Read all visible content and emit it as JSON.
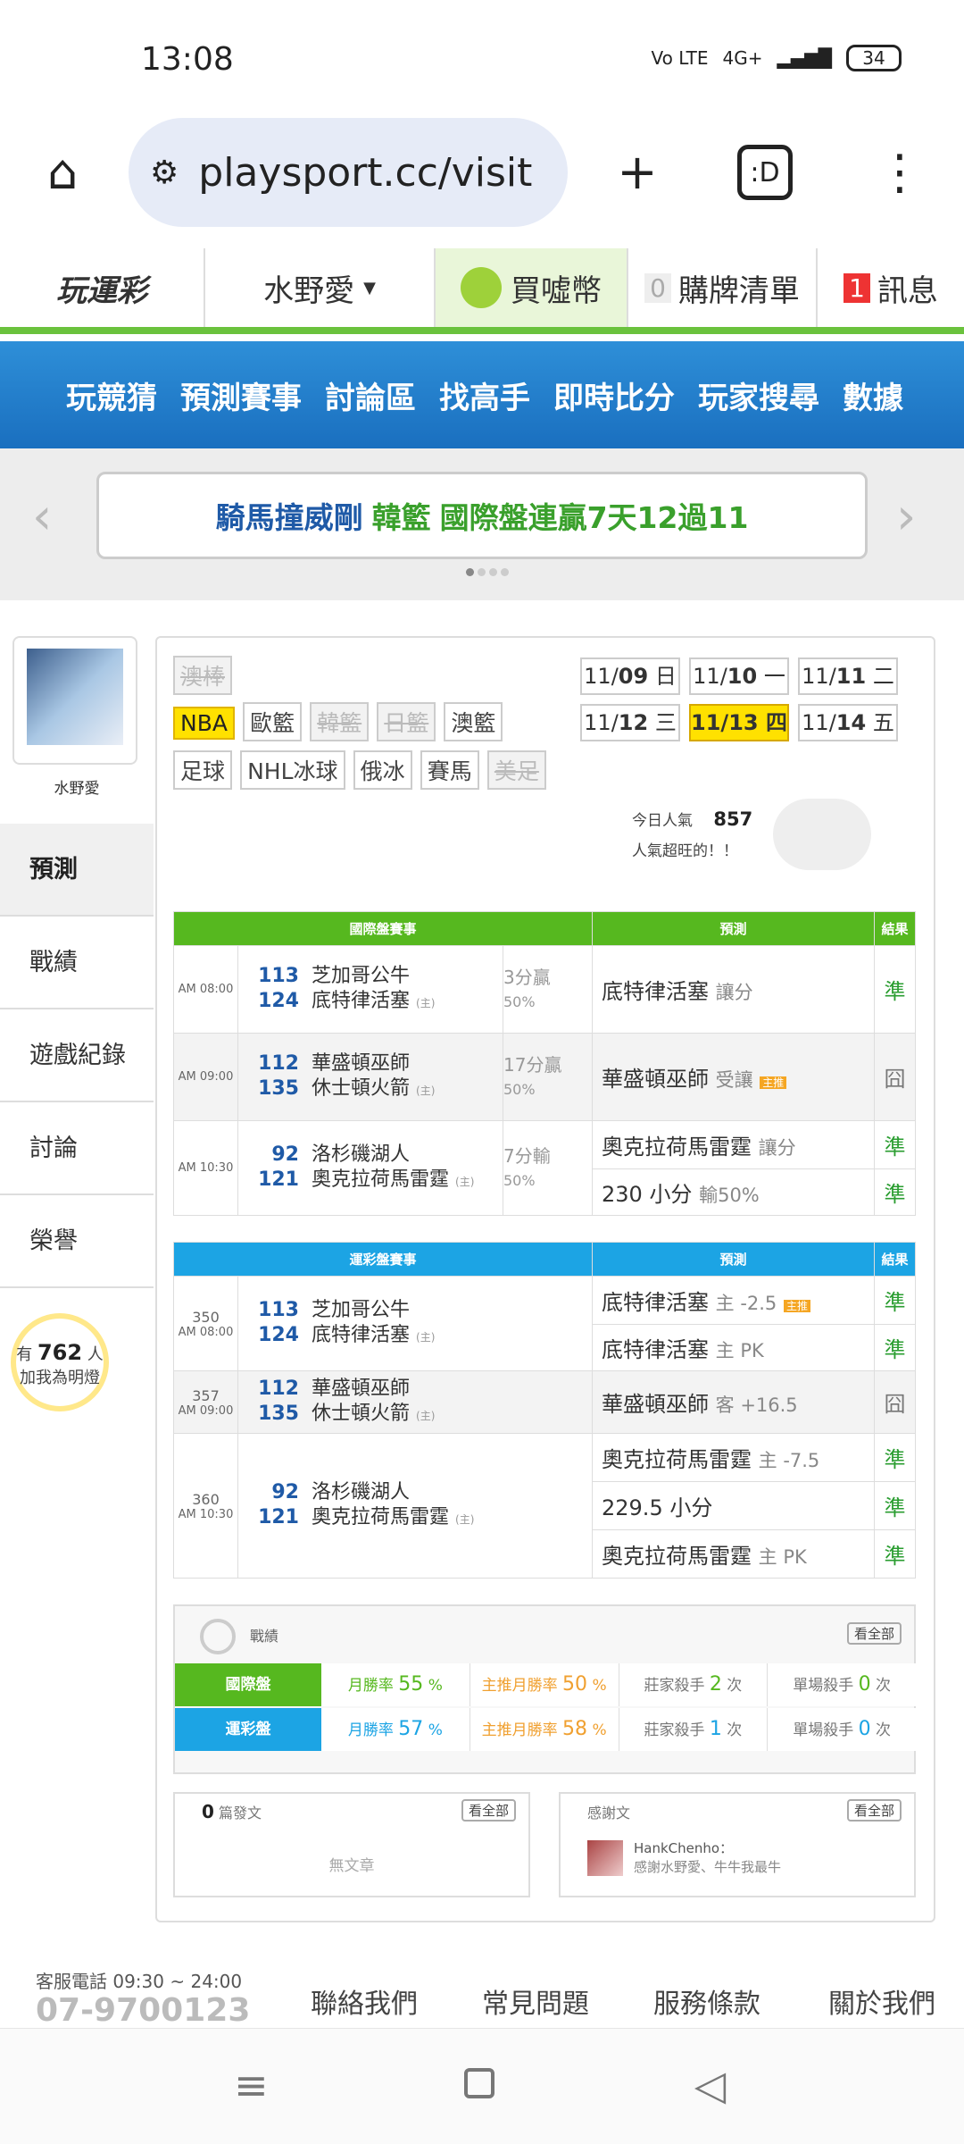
{
  "status": {
    "time": "13:08",
    "signal": "4G+",
    "volte": "Vo LTE",
    "battery": "34"
  },
  "browser": {
    "url": "playsport.cc/visit",
    "home": "⌂",
    "add": "+",
    "tabs": ":D",
    "menu": "⋮"
  },
  "site": {
    "logo": "玩運彩",
    "user": "水野愛",
    "buy": "買噓幣",
    "cart_count": "0",
    "cart": "購牌清單",
    "msg_count": "1",
    "msg": "訊息"
  },
  "nav": [
    "玩競猜",
    "預測賽事",
    "討論區",
    "找高手",
    "即時比分",
    "玩家搜尋",
    "數據"
  ],
  "banner": {
    "part1": "騎馬撞威剛",
    "part2": "韓籃",
    "part3": "國際盤連贏7天12過11"
  },
  "profile": {
    "name": "水野愛"
  },
  "sidemenu": [
    "預測",
    "戰績",
    "遊戲紀錄",
    "討論",
    "榮譽"
  ],
  "bulb": {
    "pre": "有",
    "count": "762",
    "post": "人",
    "line2": "加我為明燈"
  },
  "leagues": {
    "row0": [
      "澳棒"
    ],
    "row1": [
      "NBA",
      "歐籃",
      "韓籃",
      "日籃",
      "澳籃"
    ],
    "row2": [
      "足球",
      "NHL冰球",
      "俄冰",
      "賽馬",
      "美足"
    ]
  },
  "dates": [
    [
      "11/",
      "09",
      "日"
    ],
    [
      "11/",
      "10",
      "一"
    ],
    [
      "11/",
      "11",
      "二"
    ],
    [
      "11/",
      "12",
      "三"
    ],
    [
      "11/",
      "13",
      "四"
    ],
    [
      "11/",
      "14",
      "五"
    ]
  ],
  "popularity": {
    "label": "今日人氣",
    "value": "857",
    "note": "人氣超旺的！！"
  },
  "intl": {
    "h1": "國際盤賽事",
    "h2": "預測",
    "h3": "結果",
    "rows": [
      {
        "time": "AM 08:00",
        "n1": "113",
        "t1": "芝加哥公牛",
        "n2": "124",
        "t2": "底特律活塞",
        "home": "(主)",
        "o1": "3分贏",
        "o2": "50%",
        "pred": "底特律活塞",
        "ps": "讓分",
        "res": "準"
      },
      {
        "time": "AM 09:00",
        "n1": "112",
        "t1": "華盛頓巫師",
        "n2": "135",
        "t2": "休士頓火箭",
        "home": "(主)",
        "o1": "17分贏",
        "o2": "50%",
        "pred": "華盛頓巫師",
        "ps": "受讓",
        "badge": "主推",
        "res": "囧"
      },
      {
        "time": "AM 10:30",
        "n1": "92",
        "t1": "洛杉磯湖人",
        "n2": "121",
        "t2": "奧克拉荷馬雷霆",
        "home": "(主)",
        "o1": "7分輸",
        "o2": "50%",
        "pred": "奧克拉荷馬雷霆",
        "ps": "讓分",
        "res": "準",
        "pred2": "230 小分",
        "ps2": "輸50%",
        "res2": "準"
      }
    ]
  },
  "lottery": {
    "h1": "運彩盤賽事",
    "h2": "預測",
    "h3": "結果",
    "rows": [
      {
        "code": "350",
        "time": "AM 08:00",
        "n1": "113",
        "t1": "芝加哥公牛",
        "n2": "124",
        "t2": "底特律活塞",
        "home": "(主)",
        "preds": [
          [
            "底特律活塞",
            "主 -2.5",
            "主推",
            "準"
          ],
          [
            "底特律活塞",
            "主 PK",
            "",
            "準"
          ]
        ]
      },
      {
        "code": "357",
        "time": "AM 09:00",
        "n1": "112",
        "t1": "華盛頓巫師",
        "n2": "135",
        "t2": "休士頓火箭",
        "home": "(主)",
        "preds": [
          [
            "華盛頓巫師",
            "客 +16.5",
            "",
            "囧"
          ]
        ]
      },
      {
        "code": "360",
        "time": "AM 10:30",
        "n1": "92",
        "t1": "洛杉磯湖人",
        "n2": "121",
        "t2": "奧克拉荷馬雷霆",
        "home": "(主)",
        "preds": [
          [
            "奧克拉荷馬雷霆",
            "主 -7.5",
            "",
            "準"
          ],
          [
            "229.5 小分",
            "",
            "",
            "準"
          ],
          [
            "奧克拉荷馬雷霆",
            "主 PK",
            "",
            "準"
          ]
        ]
      }
    ]
  },
  "record": {
    "title": "戰績",
    "all": "看全部",
    "intl": {
      "label": "國際盤",
      "c1": "月勝率",
      "v1": "55",
      "c2": "主推月勝率",
      "v2": "50",
      "c3": "莊家殺手",
      "v3": "2",
      "c4": "單場殺手",
      "v4": "0"
    },
    "lot": {
      "label": "運彩盤",
      "c1": "月勝率",
      "v1": "57",
      "c2": "主推月勝率",
      "v2": "58",
      "c3": "莊家殺手",
      "v3": "1",
      "c4": "單場殺手",
      "v4": "0"
    },
    "pct": "%",
    "times": "次"
  },
  "posts": {
    "count": "0",
    "label": "篇發文",
    "all": "看全部",
    "empty": "無文章"
  },
  "thanks": {
    "label": "感謝文",
    "all": "看全部",
    "user": "HankChenho：",
    "text": "感謝水野愛、牛牛我最牛"
  },
  "footer": {
    "tel": "客服電話 09:30 ~ 24:00",
    "num": "07-9700123",
    "links": [
      "聯絡我們",
      "常見問題",
      "服務條款",
      "關於我們"
    ]
  },
  "colors": {
    "green": "#56b81f",
    "blue": "#1ca4e4",
    "nav": "#1a6fbf",
    "yellow": "#ffe100"
  }
}
